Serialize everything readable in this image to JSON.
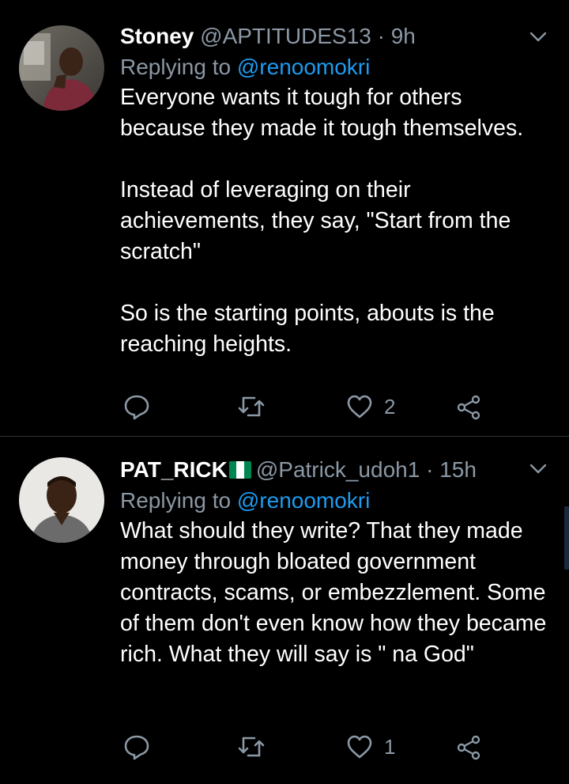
{
  "tweets": [
    {
      "display_name": "Stoney",
      "handle": "@APTITUDES13",
      "separator": "·",
      "time": "9h",
      "replying_prefix": "Replying to",
      "replying_to": "@renoomokri",
      "text": "Everyone wants it tough for others because they made it tough themselves.\n\nInstead of leveraging on their achievements, they say, \"Start from the scratch\"\n\nSo is the starting points, abouts is the reaching heights.",
      "like_count": "2",
      "icons": [
        "reply-icon",
        "retweet-icon",
        "like-icon",
        "share-icon",
        "chevron-down-icon"
      ]
    },
    {
      "display_name": "PAT_RICK",
      "flag": "nigeria-flag",
      "handle": "@Patrick_udoh1",
      "separator": "·",
      "time": "15h",
      "replying_prefix": "Replying to",
      "replying_to": "@renoomokri",
      "text": "What should they write? That they made money through bloated government contracts, scams, or embezzlement. Some of them don't even know how they became rich. What they will say is \" na God\"",
      "like_count": "1",
      "icons": [
        "reply-icon",
        "retweet-icon",
        "like-icon",
        "share-icon",
        "chevron-down-icon"
      ]
    }
  ],
  "colors": {
    "background": "#000000",
    "text": "#ffffff",
    "secondary": "#8b98a5",
    "link": "#1d9bf0",
    "divider": "#2f3336",
    "flag_green": "#008751"
  }
}
